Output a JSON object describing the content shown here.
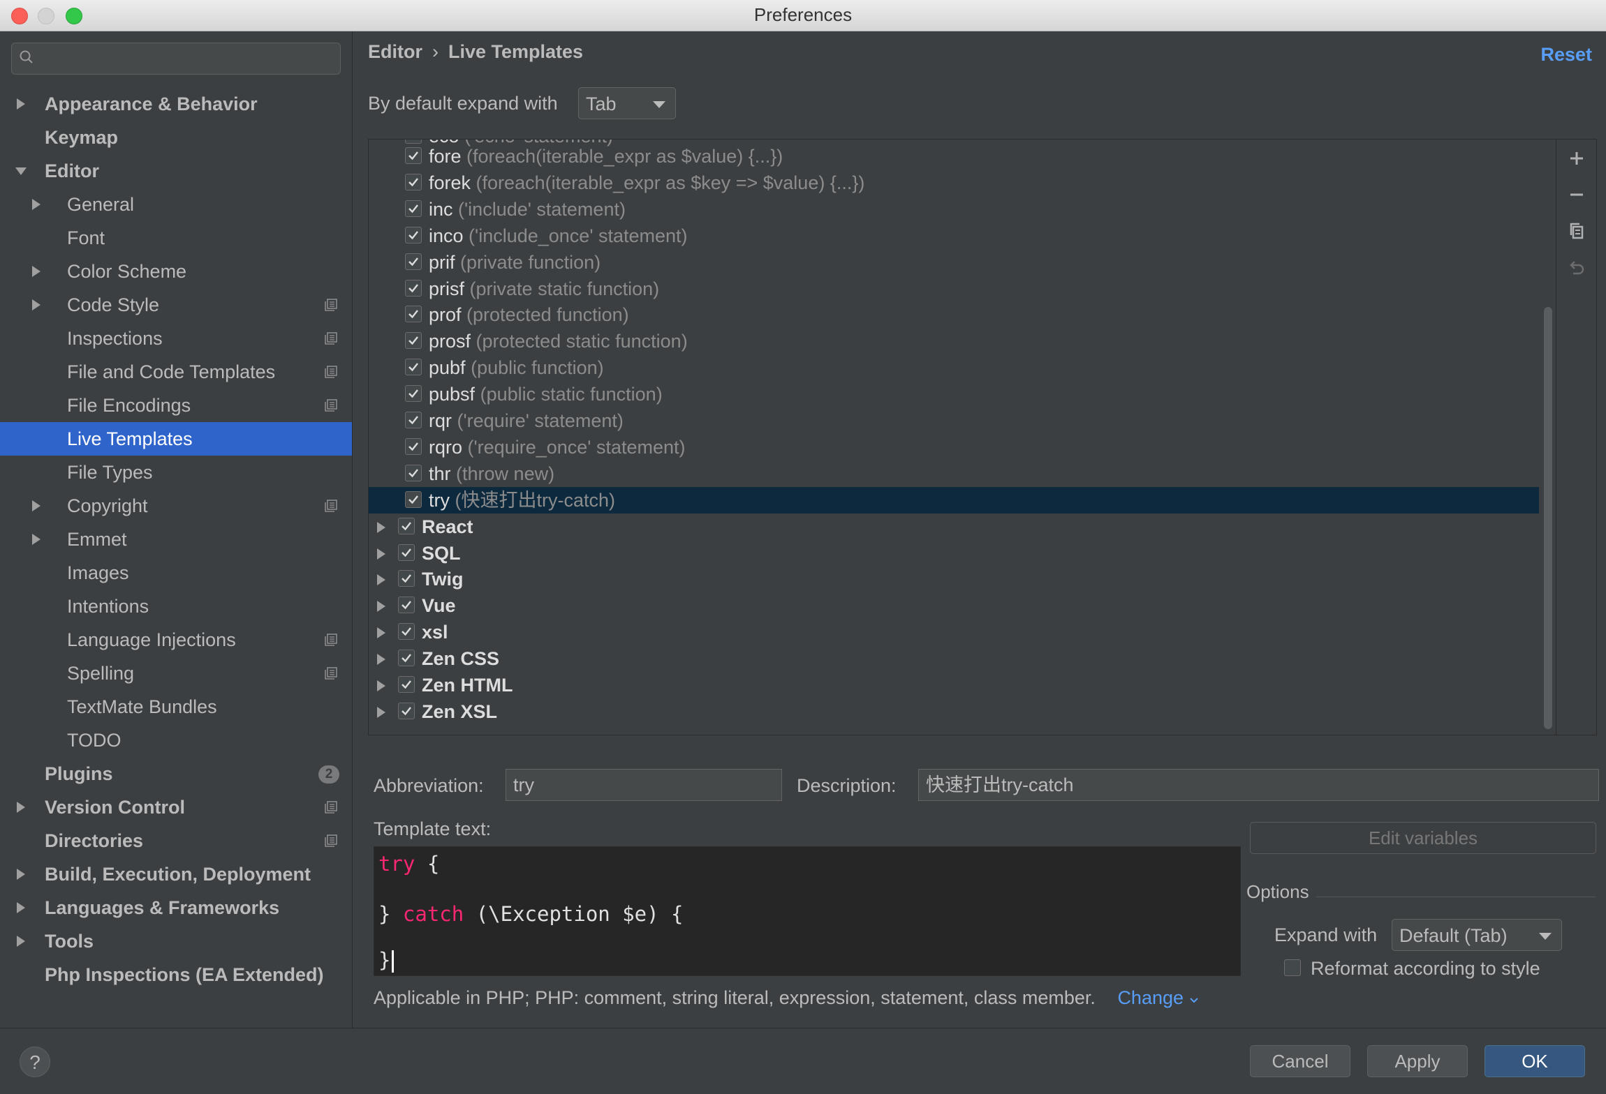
{
  "window": {
    "title": "Preferences"
  },
  "sidebar": {
    "search_placeholder": "",
    "items": [
      {
        "label": "Appearance & Behavior",
        "bold": true,
        "level": 0,
        "arrow": "right",
        "project": false
      },
      {
        "label": "Keymap",
        "bold": true,
        "level": 0,
        "arrow": "none",
        "project": false
      },
      {
        "label": "Editor",
        "bold": true,
        "level": 0,
        "arrow": "down",
        "project": false
      },
      {
        "label": "General",
        "bold": false,
        "level": 1,
        "arrow": "right",
        "project": false
      },
      {
        "label": "Font",
        "bold": false,
        "level": 1,
        "arrow": "none",
        "project": false
      },
      {
        "label": "Color Scheme",
        "bold": false,
        "level": 1,
        "arrow": "right",
        "project": false
      },
      {
        "label": "Code Style",
        "bold": false,
        "level": 1,
        "arrow": "right",
        "project": true
      },
      {
        "label": "Inspections",
        "bold": false,
        "level": 1,
        "arrow": "none",
        "project": true
      },
      {
        "label": "File and Code Templates",
        "bold": false,
        "level": 1,
        "arrow": "none",
        "project": true
      },
      {
        "label": "File Encodings",
        "bold": false,
        "level": 1,
        "arrow": "none",
        "project": true
      },
      {
        "label": "Live Templates",
        "bold": false,
        "level": 1,
        "arrow": "none",
        "project": false,
        "selected": true
      },
      {
        "label": "File Types",
        "bold": false,
        "level": 1,
        "arrow": "none",
        "project": false
      },
      {
        "label": "Copyright",
        "bold": false,
        "level": 1,
        "arrow": "right",
        "project": true
      },
      {
        "label": "Emmet",
        "bold": false,
        "level": 1,
        "arrow": "right",
        "project": false
      },
      {
        "label": "Images",
        "bold": false,
        "level": 1,
        "arrow": "none",
        "project": false
      },
      {
        "label": "Intentions",
        "bold": false,
        "level": 1,
        "arrow": "none",
        "project": false
      },
      {
        "label": "Language Injections",
        "bold": false,
        "level": 1,
        "arrow": "none",
        "project": true
      },
      {
        "label": "Spelling",
        "bold": false,
        "level": 1,
        "arrow": "none",
        "project": true
      },
      {
        "label": "TextMate Bundles",
        "bold": false,
        "level": 1,
        "arrow": "none",
        "project": false
      },
      {
        "label": "TODO",
        "bold": false,
        "level": 1,
        "arrow": "none",
        "project": false
      },
      {
        "label": "Plugins",
        "bold": true,
        "level": 0,
        "arrow": "none",
        "project": false,
        "badge": "2"
      },
      {
        "label": "Version Control",
        "bold": true,
        "level": 0,
        "arrow": "right",
        "project": true
      },
      {
        "label": "Directories",
        "bold": true,
        "level": 0,
        "arrow": "none",
        "project": true
      },
      {
        "label": "Build, Execution, Deployment",
        "bold": true,
        "level": 0,
        "arrow": "right",
        "project": false
      },
      {
        "label": "Languages & Frameworks",
        "bold": true,
        "level": 0,
        "arrow": "right",
        "project": false
      },
      {
        "label": "Tools",
        "bold": true,
        "level": 0,
        "arrow": "right",
        "project": false
      },
      {
        "label": "Php Inspections (EA Extended)",
        "bold": true,
        "level": 0,
        "arrow": "none",
        "project": false
      }
    ]
  },
  "header": {
    "crumb_parent": "Editor",
    "crumb_sep": "›",
    "crumb_current": "Live Templates",
    "reset_label": "Reset"
  },
  "expand": {
    "label": "By default expand with",
    "value": "Tab"
  },
  "templates": {
    "partial_row": {
      "abbr": "eco",
      "desc": "('echo' statement)"
    },
    "items": [
      {
        "abbr": "fore",
        "desc": "(foreach(iterable_expr as $value) {...})"
      },
      {
        "abbr": "forek",
        "desc": "(foreach(iterable_expr as $key => $value) {...})"
      },
      {
        "abbr": "inc",
        "desc": "('include' statement)"
      },
      {
        "abbr": "inco",
        "desc": "('include_once' statement)"
      },
      {
        "abbr": "prif",
        "desc": "(private function)"
      },
      {
        "abbr": "prisf",
        "desc": "(private static function)"
      },
      {
        "abbr": "prof",
        "desc": "(protected function)"
      },
      {
        "abbr": "prosf",
        "desc": "(protected static function)"
      },
      {
        "abbr": "pubf",
        "desc": "(public function)"
      },
      {
        "abbr": "pubsf",
        "desc": "(public static function)"
      },
      {
        "abbr": "rqr",
        "desc": "('require' statement)"
      },
      {
        "abbr": "rqro",
        "desc": "('require_once' statement)"
      },
      {
        "abbr": "thr",
        "desc": "(throw new)"
      },
      {
        "abbr": "try",
        "desc": "(快速打出try-catch)",
        "selected": true
      }
    ],
    "groups": [
      "React",
      "SQL",
      "Twig",
      "Vue",
      "xsl",
      "Zen CSS",
      "Zen HTML",
      "Zen XSL"
    ]
  },
  "form": {
    "abbreviation_label": "Abbreviation:",
    "abbreviation_value": "try",
    "description_label": "Description:",
    "description_value": "快速打出try-catch",
    "template_text_label": "Template text:",
    "code": {
      "kw1": "try",
      "rest1": " {",
      "brace2": "} ",
      "kw2": "catch",
      "rest2": " (\\Exception $e) {",
      "line3": "}"
    },
    "edit_variables_label": "Edit variables",
    "options_label": "Options",
    "expand_with_label": "Expand with",
    "expand_with_value": "Default (Tab)",
    "reformat_label": "Reformat according to style",
    "reformat_checked": false,
    "applicable_text": "Applicable in PHP; PHP: comment, string literal, expression, statement, class member.",
    "change_label": "Change"
  },
  "footer": {
    "help_label": "?",
    "cancel_label": "Cancel",
    "apply_label": "Apply",
    "ok_label": "OK"
  },
  "colors": {
    "accent": "#2f65ca",
    "link": "#589df6",
    "selected_row": "#0d293e",
    "keyword": "#f92672"
  }
}
